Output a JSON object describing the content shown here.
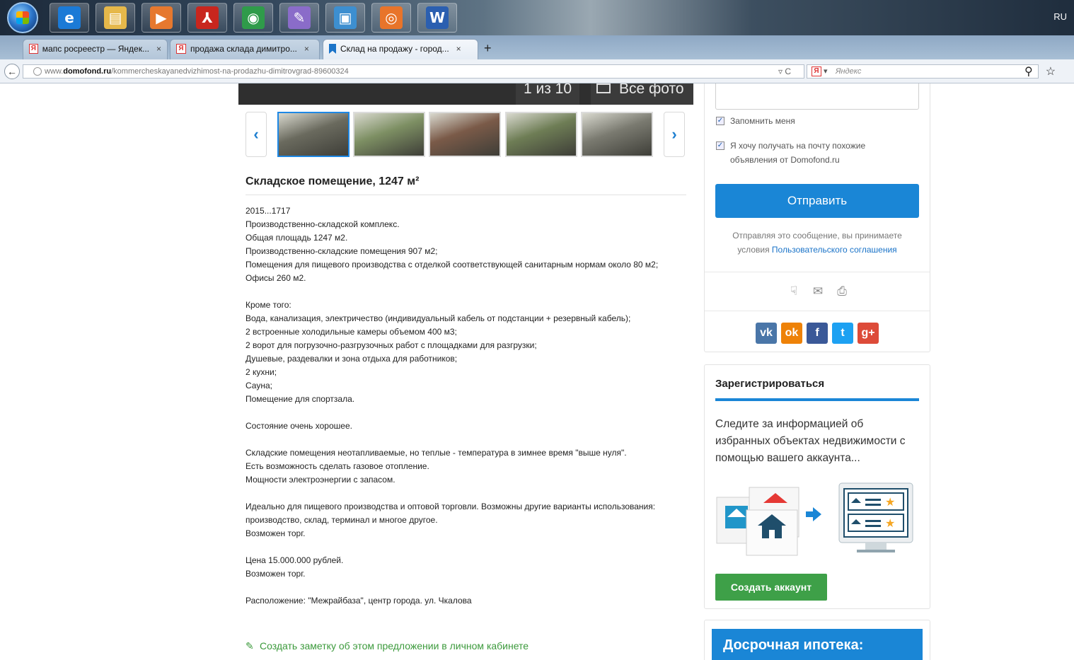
{
  "taskbar": {
    "apps": [
      {
        "name": "internet-explorer",
        "glyph": "e",
        "color": "#1b7ad6"
      },
      {
        "name": "file-explorer",
        "glyph": "▤",
        "color": "#e6b84a"
      },
      {
        "name": "media-player",
        "glyph": "▶",
        "color": "#e6782e"
      },
      {
        "name": "acrobat",
        "glyph": "⅄",
        "color": "#c8261e"
      },
      {
        "name": "chrome",
        "glyph": "◉",
        "color": "#2f9b4a"
      },
      {
        "name": "paint",
        "glyph": "✎",
        "color": "#8a6cc9"
      },
      {
        "name": "photo-viewer",
        "glyph": "▣",
        "color": "#3d8fd0"
      },
      {
        "name": "firefox",
        "glyph": "◎",
        "color": "#e8742a"
      },
      {
        "name": "word",
        "glyph": "W",
        "color": "#2b5fb0"
      }
    ],
    "language": "RU"
  },
  "tabs": [
    {
      "label": "мапс росреестр — Яндек...",
      "favicon": "Я",
      "active": false
    },
    {
      "label": "продажа склада димитро...",
      "favicon": "Я",
      "active": false
    },
    {
      "label": "Склад на продажу - город...",
      "favicon": "bookmark",
      "active": true
    }
  ],
  "tab_close": "×",
  "new_tab": "+",
  "nav": {
    "back": "←",
    "url_prefix": "www.",
    "url_domain": "domofond.ru",
    "url_path": "/kommercheskayanedvizhimost-na-prodazhu-dimitrovgrad-89600324",
    "url_tools": "▿ C",
    "search_placeholder": "Яндекс",
    "search_arrow": "▾",
    "search_icon": "⚲",
    "bookmark_icon": "☆"
  },
  "gallery": {
    "counter": "1 из 10",
    "all_photos": "Все фото",
    "prev": "‹",
    "next": "›",
    "thumb_colors": [
      "#6a6a5e",
      "#7d8f63",
      "#7a5a48",
      "#6e7d55",
      "#7a7a70"
    ]
  },
  "listing": {
    "title": "Складское помещение, 1247 м²",
    "description": "2015...1717\nПроизводственно-складской комплекс.\nОбщая площадь 1247 м2.\nПроизводственно-складские помещения 907 м2;\nПомещения для пищевого производства с отделкой соответствующей санитарным нормам около 80 м2;\nОфисы 260 м2.\n\nКроме того:\nВода, канализация, электричество (индивидуальный кабель от подстанции + резервный кабель);\n2 встроенные холодильные камеры объемом 400 м3;\n2 ворот для погрузочно-разгрузочных работ с площадками для разгрузки;\nДушевые, раздевалки и зона отдыха для работников;\n2 кухни;\nСауна;\nПомещение для спортзала.\n\nСостояние очень хорошее.\n\nСкладские помещения неотапливаемые, но теплые - температура в зимнее время \"выше нуля\".\nЕсть возможность сделать газовое отопление.\nМощности электроэнергии с запасом.\n\nИдеально для пищевого производства и оптовой торговли. Возможны другие варианты использования: производство, склад, терминал и многое другое.\nВозможен торг.\n\nЦена 15.000.000 рублей.\nВозможен торг.\n\nРасположение: \"Межрайбаза\", центр города. ул. Чкалова",
    "note_icon": "✎",
    "note_link": "Создать заметку об этом предложении в личном кабинете"
  },
  "contact_form": {
    "remember_me": "Запомнить меня",
    "subscribe": "Я хочу получать на почту похожие объявления от Domofond.ru",
    "check_mark": "✓",
    "send": "Отправить",
    "agreement_text": "Отправляя это сообщение, вы принимаете условия ",
    "agreement_link": "Пользовательского соглашения",
    "tools": {
      "thumb": "☟",
      "mail": "✉",
      "print": "⎙"
    },
    "social": [
      {
        "name": "vk",
        "label": "vk",
        "color": "#4a76a8"
      },
      {
        "name": "odnoklassniki",
        "label": "ok",
        "color": "#ee8208"
      },
      {
        "name": "facebook",
        "label": "f",
        "color": "#3b5998"
      },
      {
        "name": "twitter",
        "label": "t",
        "color": "#1da1f2"
      },
      {
        "name": "google-plus",
        "label": "g+",
        "color": "#dd4b39"
      }
    ]
  },
  "register": {
    "title": "Зарегистрироваться",
    "text": "Следите за информацией об избранных объектах недвижимости с помощью вашего аккаунта...",
    "button": "Создать аккаунт"
  },
  "mortgage": {
    "title": "Досрочная ипотека:"
  }
}
